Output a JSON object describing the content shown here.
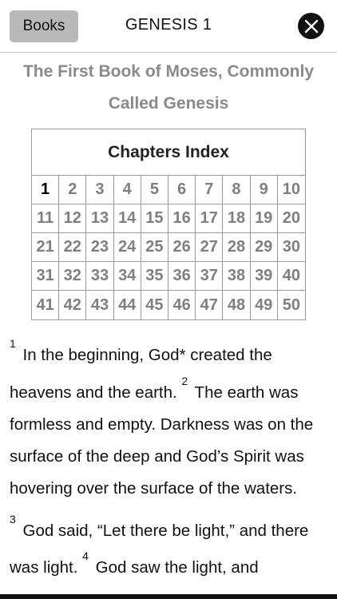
{
  "header": {
    "books_label": "Books",
    "title": "GENESIS 1",
    "close_icon": "close-icon"
  },
  "book_title": "The First Book of Moses, Commonly Called Genesis",
  "chapters_index": {
    "heading": "Chapters Index",
    "current": "1",
    "chapters": [
      "1",
      "2",
      "3",
      "4",
      "5",
      "6",
      "7",
      "8",
      "9",
      "10",
      "11",
      "12",
      "13",
      "14",
      "15",
      "16",
      "17",
      "18",
      "19",
      "20",
      "21",
      "22",
      "23",
      "24",
      "25",
      "26",
      "27",
      "28",
      "29",
      "30",
      "31",
      "32",
      "33",
      "34",
      "35",
      "36",
      "37",
      "38",
      "39",
      "40",
      "41",
      "42",
      "43",
      "44",
      "45",
      "46",
      "47",
      "48",
      "49",
      "50"
    ]
  },
  "verses": [
    {
      "num": "1",
      "text": " In the beginning, God* created the heavens and the earth. "
    },
    {
      "num": "2",
      "text": " The earth was formless and empty. Darkness was on the surface of the deep and God’s Spirit was hovering over the surface of the waters."
    },
    {
      "num": "3",
      "text": " God said, “Let there be light,” and there was light. "
    },
    {
      "num": "4",
      "text": " God saw the light, and"
    }
  ],
  "colors": {
    "books_button_bg": "#b9b9b9",
    "book_title": "#8a8a8a",
    "chapter_number": "#7f7f7f",
    "current_chapter": "#000000"
  }
}
